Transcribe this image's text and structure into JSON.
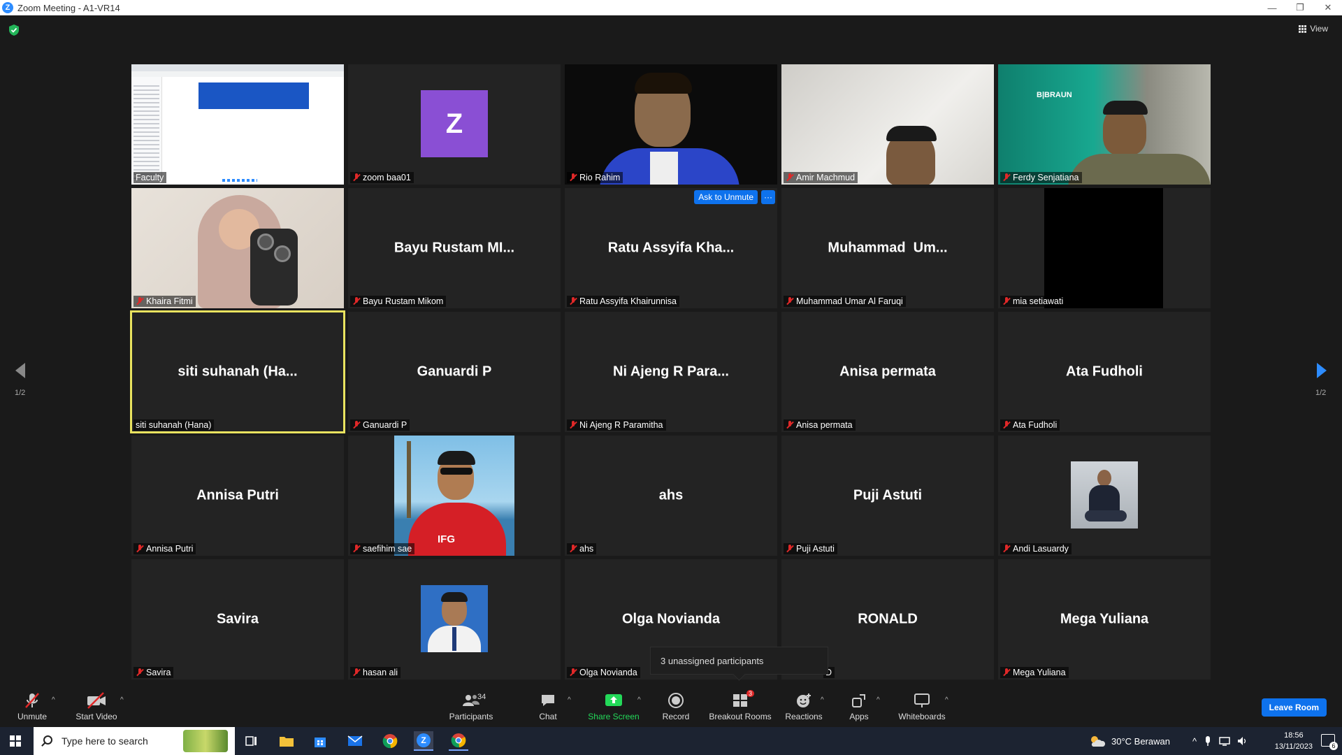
{
  "window": {
    "title": "Zoom Meeting - A1-VR14"
  },
  "top": {
    "view_label": "View"
  },
  "pagination": {
    "left": "1/2",
    "right": "1/2"
  },
  "tiles": [
    {
      "label": "Faculty",
      "muted": false,
      "big": ""
    },
    {
      "label": "zoom baa01",
      "muted": true,
      "big": "",
      "avatar_letter": "Z"
    },
    {
      "label": "Rio Rahim",
      "muted": true,
      "big": ""
    },
    {
      "label": "Amir Machmud",
      "muted": true,
      "big": ""
    },
    {
      "label": "Ferdy Senjatiana",
      "muted": true,
      "big": "",
      "banner_text": "B|BRAUN"
    },
    {
      "label": "Khaira Fitmi",
      "muted": true,
      "big": ""
    },
    {
      "label": "Bayu Rustam Mikom",
      "muted": true,
      "big": "Bayu Rustam MI..."
    },
    {
      "label": "Ratu Assyifa Khairunnisa",
      "muted": true,
      "big": "Ratu Assyifa Kha...",
      "ask_unmute": "Ask to Unmute",
      "more": "···"
    },
    {
      "label": "Muhammad Umar Al Faruqi",
      "muted": true,
      "big": "Muhammad  Um..."
    },
    {
      "label": "mia setiawati",
      "muted": true,
      "big": ""
    },
    {
      "label": "siti suhanah (Hana)",
      "muted": false,
      "big": "siti suhanah (Ha..."
    },
    {
      "label": "Ganuardi P",
      "muted": true,
      "big": "Ganuardi P"
    },
    {
      "label": "Ni Ajeng R Paramitha",
      "muted": true,
      "big": "Ni Ajeng R Para..."
    },
    {
      "label": "Anisa permata",
      "muted": true,
      "big": "Anisa permata"
    },
    {
      "label": "Ata Fudholi",
      "muted": true,
      "big": "Ata Fudholi"
    },
    {
      "label": "Annisa Putri",
      "muted": true,
      "big": "Annisa Putri"
    },
    {
      "label": "saefihim sae",
      "muted": true,
      "big": "",
      "shirt_text": "IFG"
    },
    {
      "label": "ahs",
      "muted": true,
      "big": "ahs"
    },
    {
      "label": "Puji Astuti",
      "muted": true,
      "big": "Puji Astuti"
    },
    {
      "label": "Andi Lasuardy",
      "muted": true,
      "big": ""
    },
    {
      "label": "Savira",
      "muted": true,
      "big": "Savira"
    },
    {
      "label": "hasan ali",
      "muted": true,
      "big": ""
    },
    {
      "label": "Olga Novianda",
      "muted": true,
      "big": "Olga Novianda"
    },
    {
      "label": "D",
      "muted": false,
      "big": "RONALD"
    },
    {
      "label": "Mega Yuliana",
      "muted": true,
      "big": "Mega Yuliana"
    }
  ],
  "popup": {
    "text": "3 unassigned participants"
  },
  "toolbar": {
    "unmute": "Unmute",
    "start_video": "Start Video",
    "participants": "Participants",
    "participants_count": "34",
    "chat": "Chat",
    "share_screen": "Share Screen",
    "record": "Record",
    "breakout_rooms": "Breakout Rooms",
    "breakout_badge": "3",
    "reactions": "Reactions",
    "apps": "Apps",
    "whiteboards": "Whiteboards",
    "leave": "Leave Room"
  },
  "taskbar": {
    "search_placeholder": "Type here to search",
    "weather": "30°C  Berawan",
    "time": "18:56",
    "date": "13/11/2023",
    "notif_count": "6"
  },
  "colors": {
    "accent": "#0e72ed",
    "active_speaker": "#e9e35f",
    "muted": "#e02828",
    "share_green": "#23d959"
  }
}
